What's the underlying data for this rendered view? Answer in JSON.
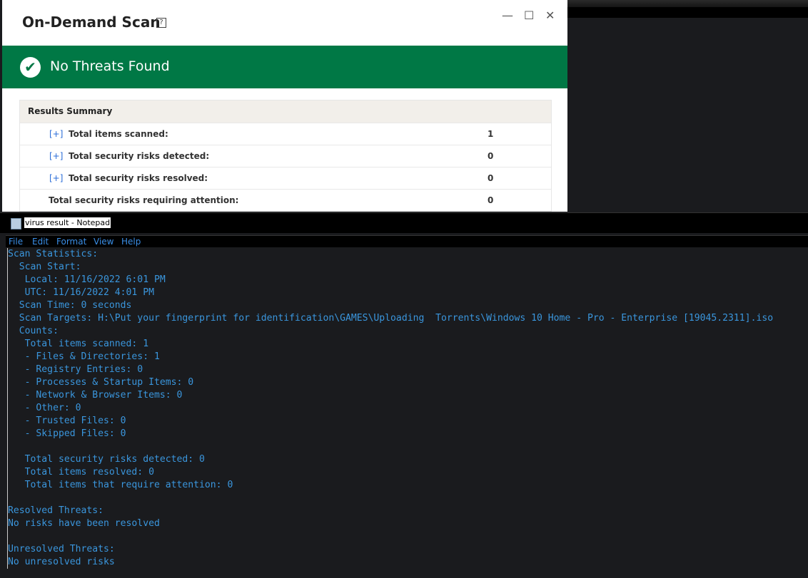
{
  "scan_window": {
    "title": "On-Demand Scan",
    "help": "?",
    "minimize": "—",
    "maximize": "☐",
    "close": "✕",
    "banner": "No Threats Found",
    "banner_color": "#007845",
    "summary_header": "Results Summary",
    "rows": [
      {
        "expand": "[+]",
        "label": "Total items scanned:",
        "value": "1"
      },
      {
        "expand": "[+]",
        "label": "Total security risks detected:",
        "value": "0"
      },
      {
        "expand": "[+]",
        "label": "Total security risks resolved:",
        "value": "0"
      },
      {
        "expand": "",
        "label": "Total security risks requiring attention:",
        "value": "0"
      }
    ]
  },
  "notepad": {
    "title": "virus result - Notepad",
    "menu": [
      "File",
      "Edit",
      "Format",
      "View",
      "Help"
    ],
    "lines": [
      "Scan Statistics:",
      "  Scan Start:",
      "   Local: 11/16/2022 6:01 PM",
      "   UTC: 11/16/2022 4:01 PM",
      "  Scan Time: 0 seconds",
      "  Scan Targets: H:\\Put your fingerprint for identification\\GAMES\\Uploading  Torrents\\Windows 10 Home - Pro - Enterprise [19045.2311].iso",
      "  Counts:",
      "   Total items scanned: 1",
      "   - Files & Directories: 1",
      "   - Registry Entries: 0",
      "   - Processes & Startup Items: 0",
      "   - Network & Browser Items: 0",
      "   - Other: 0",
      "   - Trusted Files: 0",
      "   - Skipped Files: 0",
      "",
      "   Total security risks detected: 0",
      "   Total items resolved: 0",
      "   Total items that require attention: 0",
      "",
      "Resolved Threats:",
      "No risks have been resolved",
      "",
      "Unresolved Threats:",
      "No unresolved risks"
    ]
  }
}
